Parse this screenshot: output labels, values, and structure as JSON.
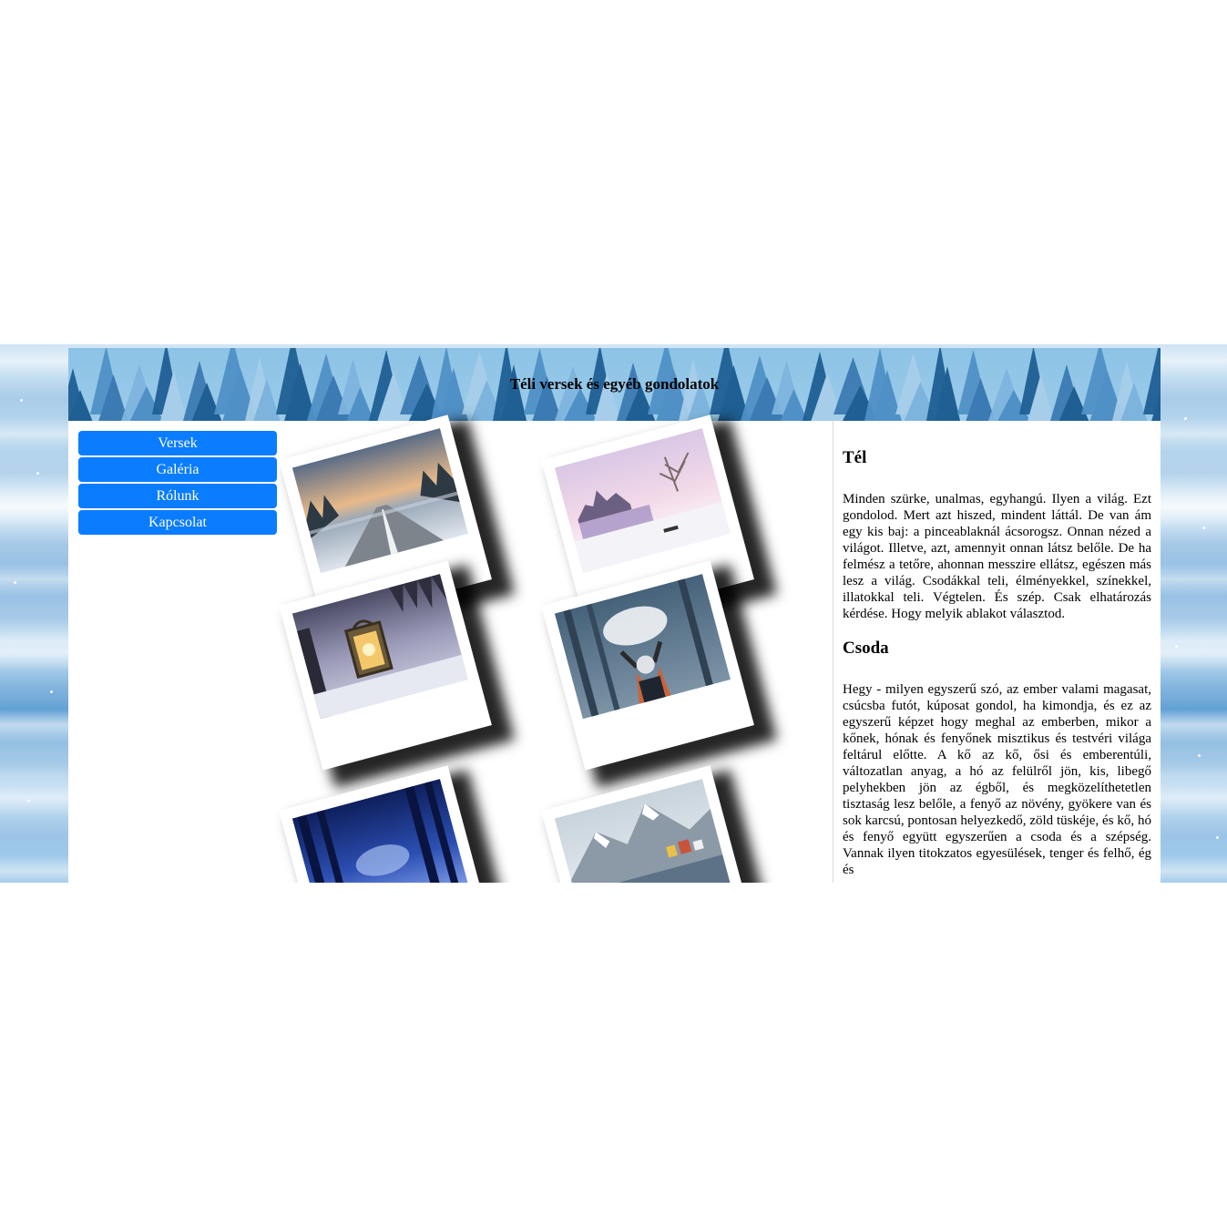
{
  "header": {
    "title": "Téli versek és egyéb gondolatok"
  },
  "nav": {
    "items": [
      {
        "label": "Versek"
      },
      {
        "label": "Galéria"
      },
      {
        "label": "Rólunk"
      },
      {
        "label": "Kapcsolat"
      }
    ]
  },
  "gallery": {
    "photos": [
      {
        "icon": "snowy-road-sunset-photo"
      },
      {
        "icon": "frozen-lake-castle-photo"
      },
      {
        "icon": "snow-lantern-photo"
      },
      {
        "icon": "girl-throwing-snow-photo"
      },
      {
        "icon": "night-snow-forest-photo"
      },
      {
        "icon": "alpine-village-lake-photo"
      }
    ]
  },
  "article": {
    "sections": [
      {
        "title": "Tél",
        "text": "Minden szürke, unalmas, egyhangú. Ilyen a világ. Ezt gondolod. Mert azt hiszed, mindent láttál. De van ám egy kis baj: a pinceablaknál ácsorogsz. Onnan nézed a világot. Illetve, azt, amennyit onnan látsz belőle. De ha felmész a tetőre, ahonnan messzire ellátsz, egészen más lesz a világ. Csodákkal teli, élményekkel, színekkel, illatokkal teli. Végtelen. És szép. Csak elhatározás kérdése. Hogy melyik ablakot választod."
      },
      {
        "title": "Csoda",
        "text": "Hegy - milyen egyszerű szó, az ember valami magasat, csúcsba futót, kúposat gondol, ha kimondja, és ez az egyszerű képzet hogy meghal az emberben, mikor a kőnek, hónak és fenyőnek misztikus és testvéri világa feltárul előtte. A kő az kő, ősi és emberentúli, változatlan anyag, a hó az felülről jön, kis, libegő pelyhekben jön az égből, és megközelíthetetlen tisztaság lesz belőle, a fenyő az növény, gyökere van és sok karcsú, pontosan helyezkedő, zöld tüskéje, és kő, hó és fenyő együtt egyszerűen a csoda és a szépség. Vannak ilyen titokzatos egyesülések, tenger és felhő, ég és"
      }
    ]
  },
  "colors": {
    "nav_button": "#0a7cff",
    "header_sky": "#8cc3e6",
    "tree_dark": "#1f5f93",
    "tree_light": "#4f90c6"
  }
}
